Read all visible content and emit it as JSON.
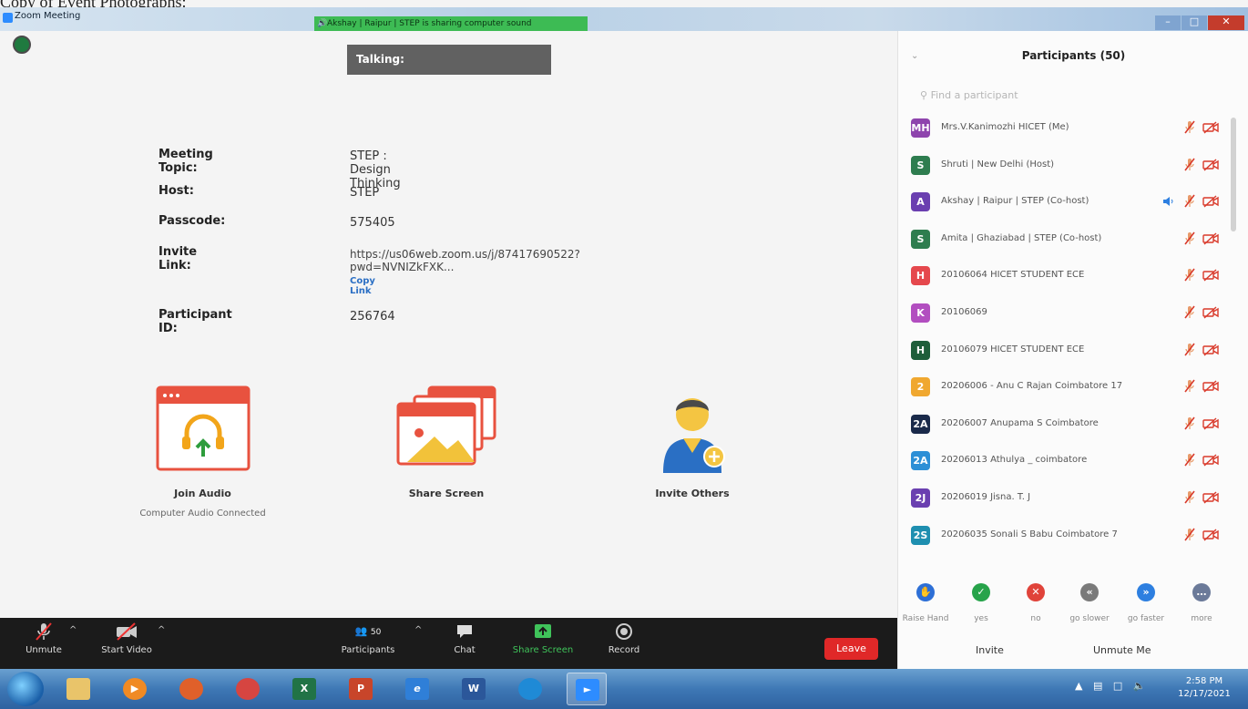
{
  "window": {
    "top_scrap": "Copy of Event Photographs:",
    "title": "Zoom Meeting",
    "share_banner": "Akshay | Raipur | STEP is sharing computer sound"
  },
  "meeting": {
    "talking_label": "Talking:",
    "topic_label": "Meeting Topic:",
    "topic": "STEP : Design Thinking",
    "host_label": "Host:",
    "host": "STEP",
    "passcode_label": "Passcode:",
    "passcode": "575405",
    "invite_label": "Invite Link:",
    "invite_link": "https://us06web.zoom.us/j/87417690522?pwd=NVNIZkFXK...",
    "copy_link": "Copy Link",
    "participant_id_label": "Participant ID:",
    "participant_id": "256764"
  },
  "actions": {
    "join_audio": "Join Audio",
    "join_audio_sub": "Computer Audio Connected",
    "share_screen": "Share Screen",
    "invite_others": "Invite Others"
  },
  "toolbar": {
    "unmute": "Unmute",
    "start_video": "Start Video",
    "participants": "Participants",
    "participants_count": "50",
    "chat": "Chat",
    "share_screen": "Share Screen",
    "record": "Record",
    "leave": "Leave"
  },
  "panel": {
    "title": "Participants (50)",
    "search_placeholder": "Find a participant",
    "participants": [
      {
        "initials": "MH",
        "name": "Mrs.V.Kanimozhi HICET (Me)",
        "color": "#8e44ad",
        "speaking": false
      },
      {
        "initials": "S",
        "name": "Shruti | New Delhi (Host)",
        "color": "#2e7d4f",
        "speaking": false
      },
      {
        "initials": "A",
        "name": "Akshay | Raipur | STEP (Co-host)",
        "color": "#6a3fb0",
        "speaking": true
      },
      {
        "initials": "S",
        "name": "Amita | Ghaziabad | STEP (Co-host)",
        "color": "#2e7d4f",
        "speaking": false
      },
      {
        "initials": "H",
        "name": "20106064 HICET STUDENT ECE",
        "color": "#e5484d",
        "speaking": false
      },
      {
        "initials": "K",
        "name": "20106069",
        "color": "#b24ec0",
        "speaking": false
      },
      {
        "initials": "H",
        "name": "20106079 HICET STUDENT ECE",
        "color": "#1e5e3a",
        "speaking": false
      },
      {
        "initials": "2",
        "name": "20206006 - Anu C Rajan Coimbatore 17",
        "color": "#f0a830",
        "speaking": false
      },
      {
        "initials": "2A",
        "name": "20206007 Anupama S Coimbatore",
        "color": "#1a2a4a",
        "speaking": false
      },
      {
        "initials": "2A",
        "name": "20206013 Athulya _ coimbatore",
        "color": "#2d8fd6",
        "speaking": false
      },
      {
        "initials": "2J",
        "name": "20206019 Jisna. T. J",
        "color": "#6a3fb0",
        "speaking": false
      },
      {
        "initials": "2S",
        "name": "20206035 Sonali S Babu Coimbatore 7",
        "color": "#1f8fb0",
        "speaking": false
      }
    ],
    "reactions": [
      {
        "label": "Raise Hand",
        "color": "#2d6fd6",
        "glyph": "✋"
      },
      {
        "label": "yes",
        "color": "#27a34a",
        "glyph": "✓"
      },
      {
        "label": "no",
        "color": "#e0433a",
        "glyph": "✕"
      },
      {
        "label": "go slower",
        "color": "#7a7a7a",
        "glyph": "«"
      },
      {
        "label": "go faster",
        "color": "#2d7fe0",
        "glyph": "»"
      },
      {
        "label": "more",
        "color": "#6b7a99",
        "glyph": "…"
      }
    ],
    "invite": "Invite",
    "unmute_me": "Unmute Me"
  },
  "taskbar": {
    "clock_time": "2:58 PM",
    "clock_date": "12/17/2021"
  }
}
